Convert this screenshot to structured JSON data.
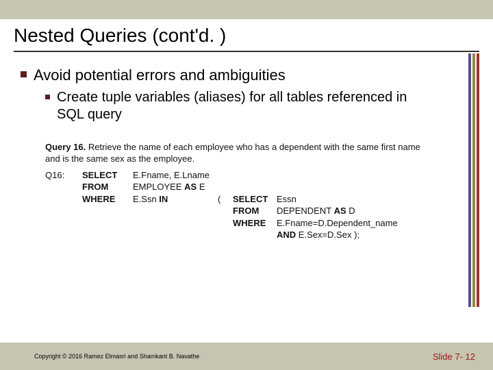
{
  "title": "Nested Queries (cont'd. )",
  "bullets": {
    "lvl1": "Avoid potential errors and ambiguities",
    "lvl2": "Create tuple variables (aliases) for all tables referenced in SQL query"
  },
  "query": {
    "label": "Query 16.",
    "description": "Retrieve the name of each employee who has a dependent with the same first name and is the same sex as the employee.",
    "qnum": "Q16:",
    "kw_select": "SELECT",
    "kw_from": "FROM",
    "kw_where": "WHERE",
    "kw_as": "AS",
    "kw_in": "IN",
    "kw_and": "AND",
    "outer_select": "E.Fname, E.Lname",
    "outer_from": "EMPLOYEE AS E",
    "outer_where_left": "E.Ssn IN",
    "inner_select": "Essn",
    "inner_from": "DEPENDENT AS D",
    "inner_where": "E.Fname=D.Dependent_name",
    "inner_and": "AND E.Sex=D.Sex );",
    "open_paren": "("
  },
  "footer": {
    "copyright": "Copyright © 2016 Ramez Elmasri and Shamkant B. Navathe",
    "slide": "Slide 7- 12"
  }
}
